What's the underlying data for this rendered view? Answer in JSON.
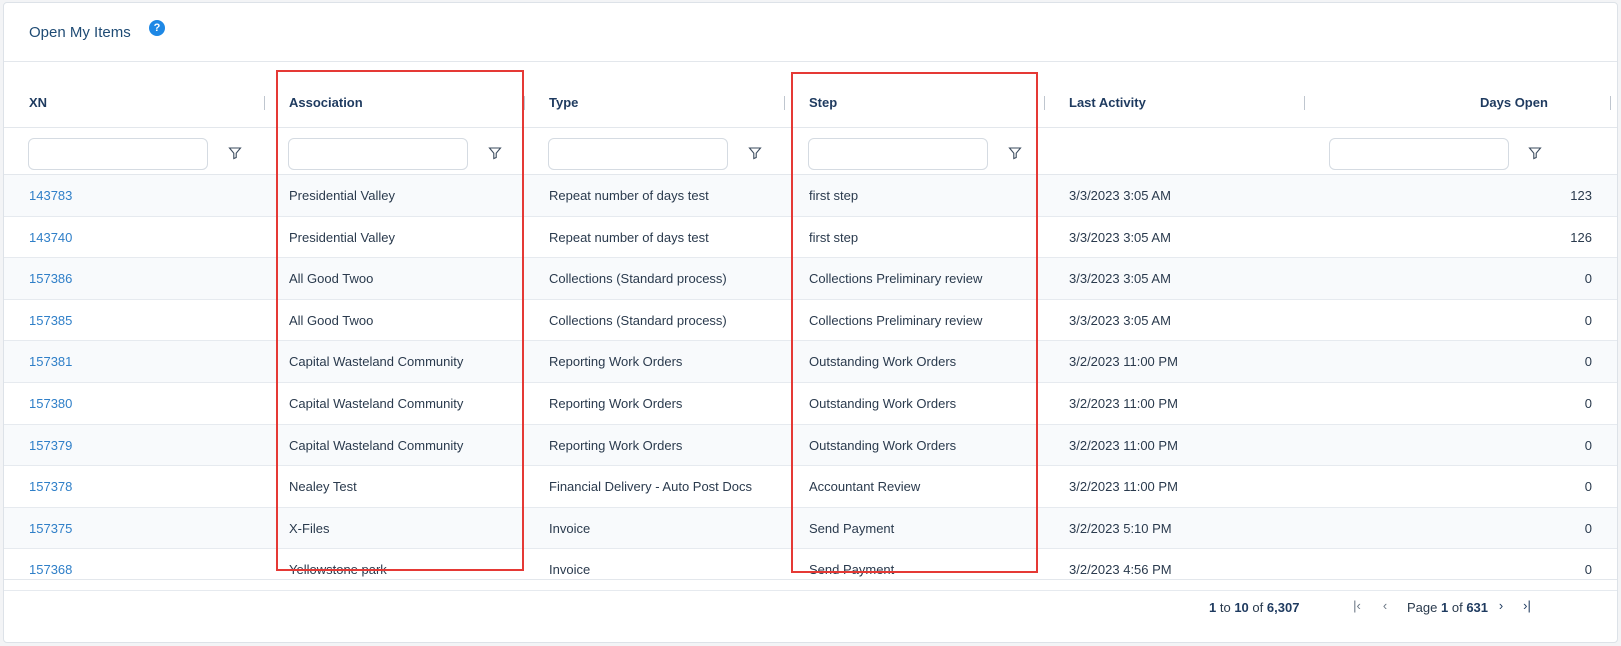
{
  "panel": {
    "title": "Open My Items",
    "help_icon": "question-circle-icon",
    "help_glyph": "?"
  },
  "columns": [
    "XN",
    "Association",
    "Type",
    "Step",
    "Last Activity",
    "Days Open"
  ],
  "rows": [
    {
      "xn": "143783",
      "association": "Presidential Valley",
      "type": "Repeat number of days test",
      "step": "first step",
      "last_activity": "3/3/2023 3:05 AM",
      "days_open": "123"
    },
    {
      "xn": "143740",
      "association": "Presidential Valley",
      "type": "Repeat number of days test",
      "step": "first step",
      "last_activity": "3/3/2023 3:05 AM",
      "days_open": "126"
    },
    {
      "xn": "157386",
      "association": "All Good Twoo",
      "type": "Collections (Standard process)",
      "step": "Collections Preliminary review",
      "last_activity": "3/3/2023 3:05 AM",
      "days_open": "0"
    },
    {
      "xn": "157385",
      "association": "All Good Twoo",
      "type": "Collections (Standard process)",
      "step": "Collections Preliminary review",
      "last_activity": "3/3/2023 3:05 AM",
      "days_open": "0"
    },
    {
      "xn": "157381",
      "association": "Capital Wasteland Community",
      "type": "Reporting Work Orders",
      "step": "Outstanding Work Orders",
      "last_activity": "3/2/2023 11:00 PM",
      "days_open": "0"
    },
    {
      "xn": "157380",
      "association": "Capital Wasteland Community",
      "type": "Reporting Work Orders",
      "step": "Outstanding Work Orders",
      "last_activity": "3/2/2023 11:00 PM",
      "days_open": "0"
    },
    {
      "xn": "157379",
      "association": "Capital Wasteland Community",
      "type": "Reporting Work Orders",
      "step": "Outstanding Work Orders",
      "last_activity": "3/2/2023 11:00 PM",
      "days_open": "0"
    },
    {
      "xn": "157378",
      "association": "Nealey Test",
      "type": "Financial Delivery - Auto Post Docs",
      "step": "Accountant Review",
      "last_activity": "3/2/2023 11:00 PM",
      "days_open": "0"
    },
    {
      "xn": "157375",
      "association": "X-Files",
      "type": "Invoice",
      "step": "Send Payment",
      "last_activity": "3/2/2023 5:10 PM",
      "days_open": "0"
    },
    {
      "xn": "157368",
      "association": "Yellowstone park",
      "type": "Invoice",
      "step": "Send Payment",
      "last_activity": "3/2/2023 4:56 PM",
      "days_open": "0"
    }
  ],
  "pager": {
    "from": "1",
    "to_word": "to",
    "to": "10",
    "of_word": "of",
    "total": "6,307",
    "page_word": "Page",
    "page": "1",
    "page_of_word": "of",
    "pages": "631",
    "first_glyph": "|‹",
    "prev_glyph": "‹",
    "next_glyph": "›",
    "last_glyph": "›|"
  },
  "colors": {
    "link": "#2f7fc8",
    "highlight": "#e53935",
    "accent": "#1e88e5"
  }
}
